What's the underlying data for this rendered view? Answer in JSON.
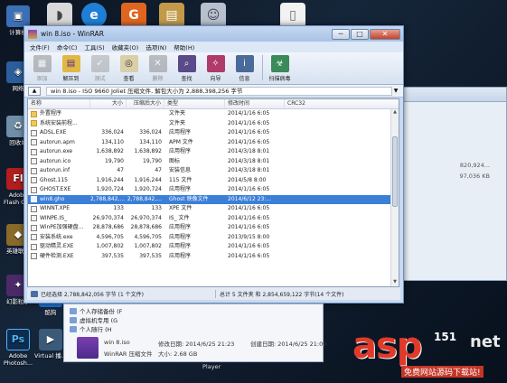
{
  "desktop": {
    "icons": [
      {
        "label": "计算机",
        "icon": "computer-icon"
      },
      {
        "label": "网络",
        "icon": "network-icon"
      },
      {
        "label": "回收站",
        "icon": "recycle-bin-icon"
      },
      {
        "label": "Adobe Flash CS3",
        "icon": "flash-icon"
      },
      {
        "label": "英雄联盟",
        "icon": "game-icon"
      },
      {
        "label": "幻影粒子",
        "icon": "app-icon"
      },
      {
        "label": "酷狗",
        "icon": "app-icon"
      },
      {
        "label": "Adobe Photosh...",
        "icon": "photoshop-icon"
      },
      {
        "label": "Virtual 播...",
        "icon": "app-icon"
      }
    ],
    "top_icons": [
      "mouse-icon",
      "ie-icon",
      "office-icon",
      "folder-icon",
      "user-icon",
      "document-icon"
    ]
  },
  "back_window": {
    "sizes": [
      "820,924...",
      "97,036 KB"
    ]
  },
  "winrar": {
    "title": "win 8.iso - WinRAR",
    "window_buttons": {
      "minimize": "─",
      "maximize": "□",
      "close": "✕"
    },
    "menu": [
      "文件(F)",
      "命令(C)",
      "工具(S)",
      "收藏夹(O)",
      "选项(N)",
      "帮助(H)"
    ],
    "toolbar": [
      {
        "label": "添加",
        "icon": "add-icon",
        "enabled": false
      },
      {
        "label": "解压到",
        "icon": "extract-icon",
        "enabled": true
      },
      {
        "label": "测试",
        "icon": "test-icon",
        "enabled": false
      },
      {
        "label": "查看",
        "icon": "view-icon",
        "enabled": true
      },
      {
        "label": "删除",
        "icon": "delete-icon",
        "enabled": false
      },
      {
        "label": "查找",
        "icon": "find-icon",
        "enabled": true
      },
      {
        "label": "向导",
        "icon": "wizard-icon",
        "enabled": true
      },
      {
        "label": "信息",
        "icon": "info-icon",
        "enabled": true
      },
      {
        "label": "扫描病毒",
        "icon": "virus-scan-icon",
        "enabled": true
      }
    ],
    "path": "win 8.iso - ISO 9660 Joliet 压缩文件, 解包大小为 2,888,398,256 字节",
    "columns": [
      "名称",
      "大小",
      "压缩后大小",
      "类型",
      "修改时间",
      "CRC32"
    ],
    "rows": [
      {
        "name": "外置程序",
        "size": "",
        "packed": "",
        "type": "文件夹",
        "modified": "2014/1/16 6:05",
        "crc": "",
        "folder": true,
        "selected": false
      },
      {
        "name": "系统安装前程...",
        "size": "",
        "packed": "",
        "type": "文件夹",
        "modified": "2014/1/16 6:05",
        "crc": "",
        "folder": true,
        "selected": false
      },
      {
        "name": "ADSL.EXE",
        "size": "336,024",
        "packed": "336,024",
        "type": "应用程序",
        "modified": "2014/1/16 6:05",
        "crc": "",
        "folder": false,
        "selected": false
      },
      {
        "name": "autorun.apm",
        "size": "134,110",
        "packed": "134,110",
        "type": "APM 文件",
        "modified": "2014/1/16 6:05",
        "crc": "",
        "folder": false,
        "selected": false
      },
      {
        "name": "autorun.exe",
        "size": "1,638,892",
        "packed": "1,638,892",
        "type": "应用程序",
        "modified": "2014/3/18 8:01",
        "crc": "",
        "folder": false,
        "selected": false
      },
      {
        "name": "autorun.ico",
        "size": "19,790",
        "packed": "19,790",
        "type": "图标",
        "modified": "2014/3/18 8:01",
        "crc": "",
        "folder": false,
        "selected": false
      },
      {
        "name": "autorun.inf",
        "size": "47",
        "packed": "47",
        "type": "安装信息",
        "modified": "2014/3/18 8:01",
        "crc": "",
        "folder": false,
        "selected": false
      },
      {
        "name": "Ghost.115",
        "size": "1,916,244",
        "packed": "1,916,244",
        "type": "115 文件",
        "modified": "2014/5/8 8:00",
        "crc": "",
        "folder": false,
        "selected": false
      },
      {
        "name": "GHOST.EXE",
        "size": "1,920,724",
        "packed": "1,920,724",
        "type": "应用程序",
        "modified": "2014/1/16 6:05",
        "crc": "",
        "folder": false,
        "selected": false
      },
      {
        "name": "win8.gho",
        "size": "2,788,842,...",
        "packed": "2,788,842,...",
        "type": "Ghost 映像文件",
        "modified": "2014/6/12 23:...",
        "crc": "",
        "folder": false,
        "selected": true
      },
      {
        "name": "WINNT.XPE",
        "size": "133",
        "packed": "133",
        "type": "XPE 文件",
        "modified": "2014/1/16 6:05",
        "crc": "",
        "folder": false,
        "selected": false
      },
      {
        "name": "WINPE.IS_",
        "size": "26,970,374",
        "packed": "26,970,374",
        "type": "IS_ 文件",
        "modified": "2014/1/16 6:05",
        "crc": "",
        "folder": false,
        "selected": false
      },
      {
        "name": "WinPE加强硬盘...",
        "size": "28,878,686",
        "packed": "28,878,686",
        "type": "应用程序",
        "modified": "2014/1/16 6:05",
        "crc": "",
        "folder": false,
        "selected": false
      },
      {
        "name": "安装系统.exe",
        "size": "4,596,705",
        "packed": "4,596,705",
        "type": "应用程序",
        "modified": "2013/9/15 8:00",
        "crc": "",
        "folder": false,
        "selected": false
      },
      {
        "name": "驱动精灵.EXE",
        "size": "1,007,802",
        "packed": "1,007,802",
        "type": "应用程序",
        "modified": "2014/1/16 6:05",
        "crc": "",
        "folder": false,
        "selected": false
      },
      {
        "name": "硬件检测.EXE",
        "size": "397,535",
        "packed": "397,535",
        "type": "应用程序",
        "modified": "2014/1/16 6:05",
        "crc": "",
        "folder": false,
        "selected": false
      }
    ],
    "status_left": "已经选择 2,788,842,056 字节 (1 个文件)",
    "status_right": "总计 5 文件夹 和 2,854,659,122 字节(14 个文件)"
  },
  "lower_panel": {
    "nav": [
      "个人存储备份 (F",
      "虚拟机专用 (G",
      "个人随行 (H"
    ],
    "file_name": "win 8.iso",
    "file_type": "WinRAR 压缩文件",
    "modified_label": "修改日期: 2014/6/25 21:23",
    "size_label": "大小: 2.68 GB",
    "created_label": "创建日期: 2014/6/25 21:09"
  },
  "taskbar": {
    "player_label": "Player"
  },
  "watermark": {
    "main": "asp",
    "net": "net",
    "number": "151",
    "sub": "免费网站源码下载站!"
  }
}
